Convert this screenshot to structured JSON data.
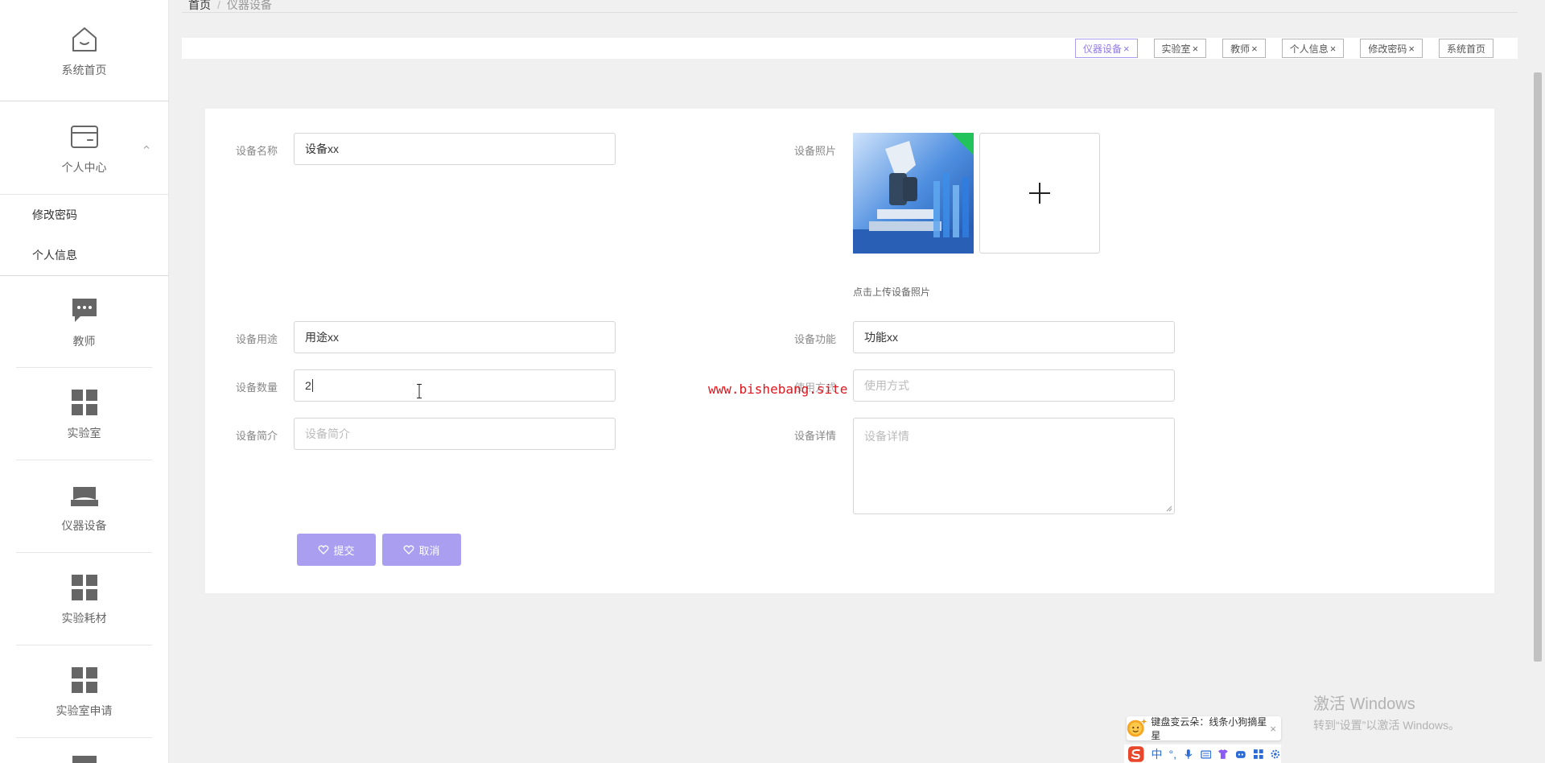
{
  "breadcrumb": {
    "home": "首页",
    "separator": "/",
    "current": "仪器设备"
  },
  "sidebar": {
    "home_label": "系统首页",
    "personal": {
      "label": "个人中心",
      "subitems": [
        "修改密码",
        "个人信息"
      ]
    },
    "items": [
      {
        "label": "教师",
        "icon": "chat-icon"
      },
      {
        "label": "实验室",
        "icon": "grid-icon"
      },
      {
        "label": "仪器设备",
        "icon": "store-icon"
      },
      {
        "label": "实验耗材",
        "icon": "grid-icon"
      },
      {
        "label": "实验室申请",
        "icon": "grid-icon"
      }
    ]
  },
  "tags": [
    {
      "label": "仪器设备",
      "close": "×",
      "active": true
    },
    {
      "label": "实验室",
      "close": "×"
    },
    {
      "label": "教师",
      "close": "×"
    },
    {
      "label": "个人信息",
      "close": "×"
    },
    {
      "label": "修改密码",
      "close": "×"
    },
    {
      "label": "系统首页"
    }
  ],
  "form": {
    "name": {
      "label": "设备名称",
      "value": "设备xx"
    },
    "photo": {
      "label": "设备照片",
      "hint": "点击上传设备照片"
    },
    "usage": {
      "label": "设备用途",
      "value": "用途xx"
    },
    "function": {
      "label": "设备功能",
      "value": "功能xx"
    },
    "quantity": {
      "label": "设备数量",
      "value": "2"
    },
    "method": {
      "label": "使用方式",
      "placeholder": "使用方式"
    },
    "intro": {
      "label": "设备简介",
      "placeholder": "设备简介"
    },
    "detail": {
      "label": "设备详情",
      "placeholder": "设备详情"
    },
    "submit_label": "提交",
    "cancel_label": "取消"
  },
  "watermark": "www.bishebang.site",
  "windows_activation": {
    "title": "激活 Windows",
    "subtitle": "转到“设置”以激活 Windows。"
  },
  "ime": {
    "tip": "键盘变云朵：线条小狗摘星星",
    "close": "×",
    "lang": "中",
    "punct": "°,"
  },
  "colors": {
    "accent": "#a99ef0",
    "accent_text": "#8f7ae8",
    "watermark": "#e0151d"
  }
}
